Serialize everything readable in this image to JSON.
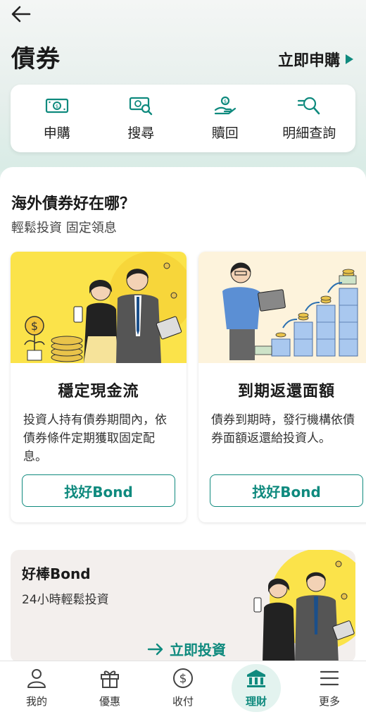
{
  "header": {
    "title": "債券",
    "apply_now": "立即申購"
  },
  "quick_actions": [
    {
      "label": "申購",
      "icon": "banknote-icon"
    },
    {
      "label": "搜尋",
      "icon": "banknote-search-icon"
    },
    {
      "label": "贖回",
      "icon": "hand-coin-icon"
    },
    {
      "label": "明細查詢",
      "icon": "magnifier-list-icon"
    }
  ],
  "section": {
    "title": "海外債券好在哪？",
    "subtitle": "輕鬆投資 固定領息"
  },
  "features": [
    {
      "title": "穩定現金流",
      "desc": "投資人持有債券期間內，依債券條件定期獲取固定配息。",
      "button": "找好Bond"
    },
    {
      "title": "到期返還面額",
      "desc": "債券到期時，發行機構依債券面額返還給投資人。",
      "button": "找好Bond"
    }
  ],
  "promo": {
    "title": "好棒Bond",
    "subtitle": "24小時輕鬆投資",
    "link": "立即投資"
  },
  "tabs": [
    {
      "label": "我的",
      "icon": "person-icon"
    },
    {
      "label": "優惠",
      "icon": "gift-icon"
    },
    {
      "label": "收付",
      "icon": "dollar-circle-icon"
    },
    {
      "label": "理財",
      "icon": "bank-icon",
      "active": true
    },
    {
      "label": "更多",
      "icon": "menu-icon"
    }
  ],
  "colors": {
    "accent": "#0f8a7e",
    "card_yellow": "#fbe34a",
    "card_cream": "#fdf3dc"
  }
}
